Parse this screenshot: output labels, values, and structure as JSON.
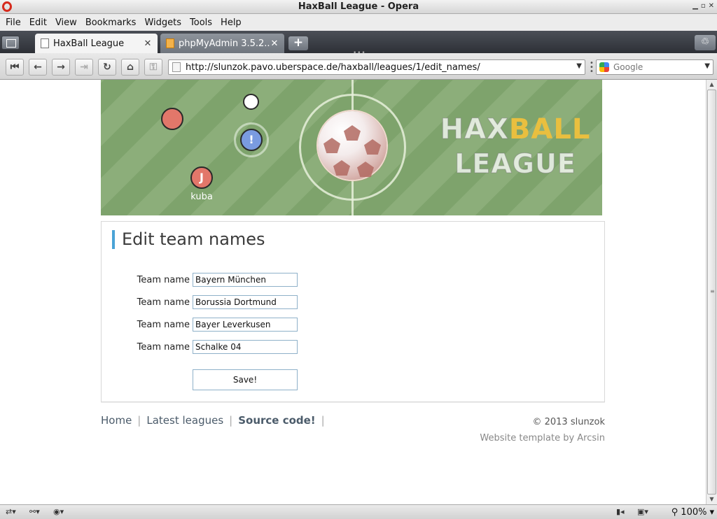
{
  "window": {
    "title": "HaxBall League - Opera"
  },
  "menu": {
    "items": [
      {
        "label": "File"
      },
      {
        "label": "Edit"
      },
      {
        "label": "View"
      },
      {
        "label": "Bookmarks"
      },
      {
        "label": "Widgets"
      },
      {
        "label": "Tools"
      },
      {
        "label": "Help"
      }
    ]
  },
  "tabs": [
    {
      "label": "HaxBall League",
      "active": true
    },
    {
      "label": "phpMyAdmin 3.5.2...",
      "active": false
    }
  ],
  "address": {
    "url": "http://slunzok.pavo.uberspace.de/haxball/leagues/1/edit_names/",
    "search_placeholder": "Google"
  },
  "banner": {
    "player_avatar": "J",
    "player_badge": "!",
    "player_name": "kuba",
    "logo_part1": "HAX",
    "logo_part2": "BALL",
    "logo_line2": "LEAGUE"
  },
  "page": {
    "title": "Edit team names",
    "team_label": "Team name",
    "teams": [
      "Bayern München",
      "Borussia Dortmund",
      "Bayer Leverkusen",
      "Schalke 04"
    ],
    "save_label": "Save!"
  },
  "footer": {
    "links": [
      {
        "label": "Home"
      },
      {
        "label": "Latest leagues"
      },
      {
        "label": "Source code!"
      }
    ],
    "copyright": "© 2013 slunzok",
    "template_credit": "Website template by Arcsin"
  },
  "statusbar": {
    "zoom": "100%"
  },
  "colors": {
    "accent": "#4aa3d6",
    "brand_gold": "#e9bf3f",
    "pitch_green": "#8cae7a",
    "player_red": "#e2776a",
    "player_blue": "#7a9be0"
  }
}
